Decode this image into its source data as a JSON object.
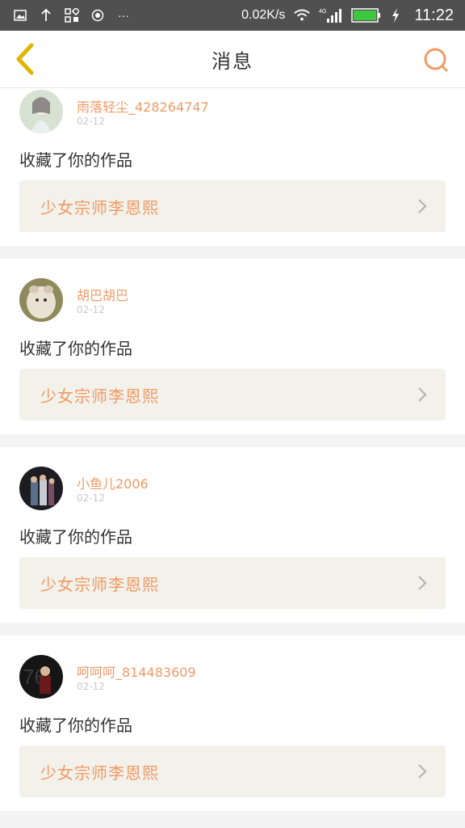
{
  "status_bar": {
    "speed": "0.02K/s",
    "time": "11:22",
    "network": "4G"
  },
  "header": {
    "title": "消息"
  },
  "colors": {
    "accent": "#f09a66",
    "back_icon": "#e0b500",
    "card_bg": "#f2f1ea"
  },
  "messages": [
    {
      "username": "雨落轻尘_428264747",
      "date": "02-12",
      "action": "收藏了你的作品",
      "work_title": "少女宗师李恩熙"
    },
    {
      "username": "胡巴胡巴",
      "date": "02-12",
      "action": "收藏了你的作品",
      "work_title": "少女宗师李恩熙"
    },
    {
      "username": "小鱼儿2006",
      "date": "02-12",
      "action": "收藏了你的作品",
      "work_title": "少女宗师李恩熙"
    },
    {
      "username": "呵呵呵_814483609",
      "date": "02-12",
      "action": "收藏了你的作品",
      "work_title": "少女宗师李恩熙"
    }
  ]
}
